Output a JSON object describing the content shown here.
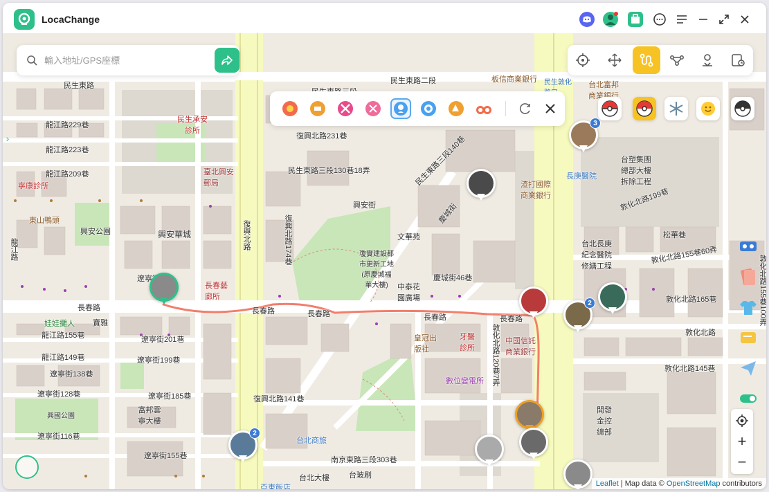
{
  "app": {
    "title": "LocaChange",
    "accent": "#2ec08a"
  },
  "titlebar": {
    "icons": [
      "discord-icon",
      "avatar-icon",
      "toolbox-icon",
      "chat-icon",
      "menu-icon",
      "minimize-icon",
      "maximize-icon",
      "close-icon"
    ]
  },
  "search": {
    "placeholder": "輸入地址/GPS座標",
    "value": ""
  },
  "modes": {
    "items": [
      "teleport-mode",
      "joystick-mode",
      "two-spot-route-mode",
      "multi-spot-route-mode",
      "jump-teleport-mode",
      "history-mode"
    ],
    "active": "two-spot-route-mode"
  },
  "route_bar": {
    "speeds": [
      "speed-1",
      "speed-2",
      "speed-3",
      "speed-4",
      "speed-5",
      "speed-6",
      "speed-7",
      "speed-8"
    ],
    "selected": "speed-5"
  },
  "poke_bar": {
    "items": [
      "pokeball-icon",
      "pokestop-icon",
      "snowflake-icon",
      "smiley-icon",
      "pokeball-dark-icon"
    ]
  },
  "side_tools": [
    "vr-icon",
    "cards-icon",
    "shirt-icon",
    "sticker-icon",
    "send-icon",
    "toggle-icon"
  ],
  "zoom": {
    "plus": "+",
    "minus": "−"
  },
  "attribution": {
    "leaflet": "Leaflet",
    "sep": " | Map data © ",
    "osm": "OpenStreetMap",
    "contributors": " contributors"
  },
  "map_labels": {
    "l01": "民生東路",
    "l02": "民生東路二段",
    "l03": "民生東路三段",
    "l04": "板信商業銀行",
    "l05": "民生敦化路口",
    "l06": "台北富邦商業銀行",
    "l07": "民生承安診所",
    "l08": "龍江路229巷",
    "l09": "龍江路223巷",
    "l10": "龍江路209巷",
    "l11": "東山鴨頭",
    "l12": "興安華城",
    "l13": "興安公園",
    "l14": "復興北路231巷",
    "l15": "民生東路三段130巷18弄",
    "l16": "民生東路三段140巷",
    "l17": "興安街",
    "l18": "文華苑",
    "l19": "慶城街",
    "l20": "中泰花園廣場",
    "l21": "慶城街46巷",
    "l22": "長春路",
    "l23": "遼寧街",
    "l24": "龍江路155巷",
    "l25": "龍江路149巷",
    "l26": "遼寧街201巷",
    "l27": "遼寧街199巷",
    "l28": "遼寧街138巷",
    "l29": "遼寧街128巷",
    "l30": "遼寧街185巷",
    "l31": "興國公園",
    "l32": "富邦雲寧大樓",
    "l33": "遼寧街116巷",
    "l34": "遼寧街155巷",
    "l35": "復興北路141巷",
    "l36": "台北商旅",
    "l37": "南京東路三段303巷",
    "l38": "敦化北路120巷7弄",
    "l39": "中國信託商業銀行",
    "l40": "皇冠出版社",
    "l41": "數位變電所",
    "l42": "渣打國際商業銀行",
    "l43": "長庚醫院",
    "l44": "台塑集團總部大樓拆除工程",
    "l45": "敦化北路199巷",
    "l46": "台北長庚紀念醫院修繕工程",
    "l47": "敦化北路155巷60弄",
    "l48": "敦化北路165巷",
    "l49": "敦化北路",
    "l50": "敦化北路145巷",
    "l51": "開發金控總部",
    "l52": "復興北路",
    "l53": "敦化北路155巷100弄",
    "l54": "長春藝廊所",
    "l55": "寶雅",
    "l56": "娃娃攤人",
    "l57": "寧康診所",
    "l58": "臺北興安郵局",
    "l59": "牙醫診所",
    "l60": "台北大樓",
    "l61": "台玻刷",
    "l62": "亞東飯店",
    "l63": "松華巷",
    "l64": "瓊實建設都市更新工地(原慶城福華大樓)",
    "l65": "復興北路174巷",
    "l66": "龍江路"
  }
}
